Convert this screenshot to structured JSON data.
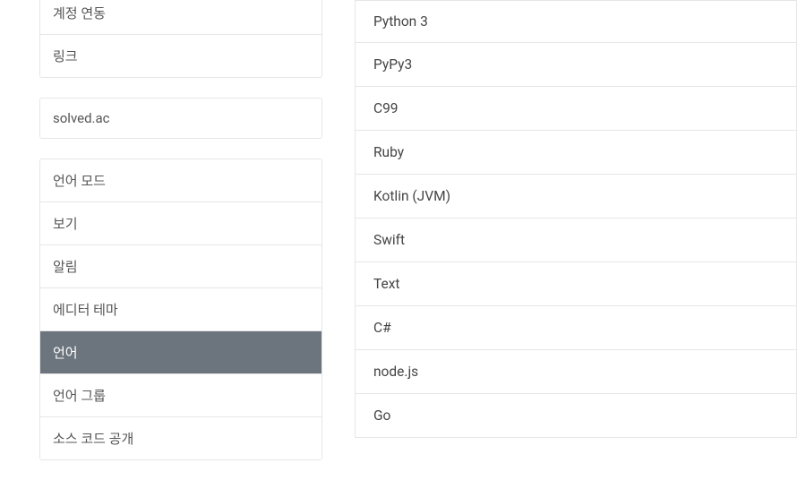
{
  "sidebar": {
    "group1": [
      {
        "label": "계정 연동"
      },
      {
        "label": "링크"
      }
    ],
    "group2": [
      {
        "label": "solved.ac"
      }
    ],
    "group3": [
      {
        "label": "언어 모드",
        "active": false
      },
      {
        "label": "보기",
        "active": false
      },
      {
        "label": "알림",
        "active": false
      },
      {
        "label": "에디터 테마",
        "active": false
      },
      {
        "label": "언어",
        "active": true
      },
      {
        "label": "언어 그룹",
        "active": false
      },
      {
        "label": "소스 코드 공개",
        "active": false
      }
    ]
  },
  "languages": [
    "Python 3",
    "PyPy3",
    "C99",
    "Ruby",
    "Kotlin (JVM)",
    "Swift",
    "Text",
    "C#",
    "node.js",
    "Go"
  ]
}
